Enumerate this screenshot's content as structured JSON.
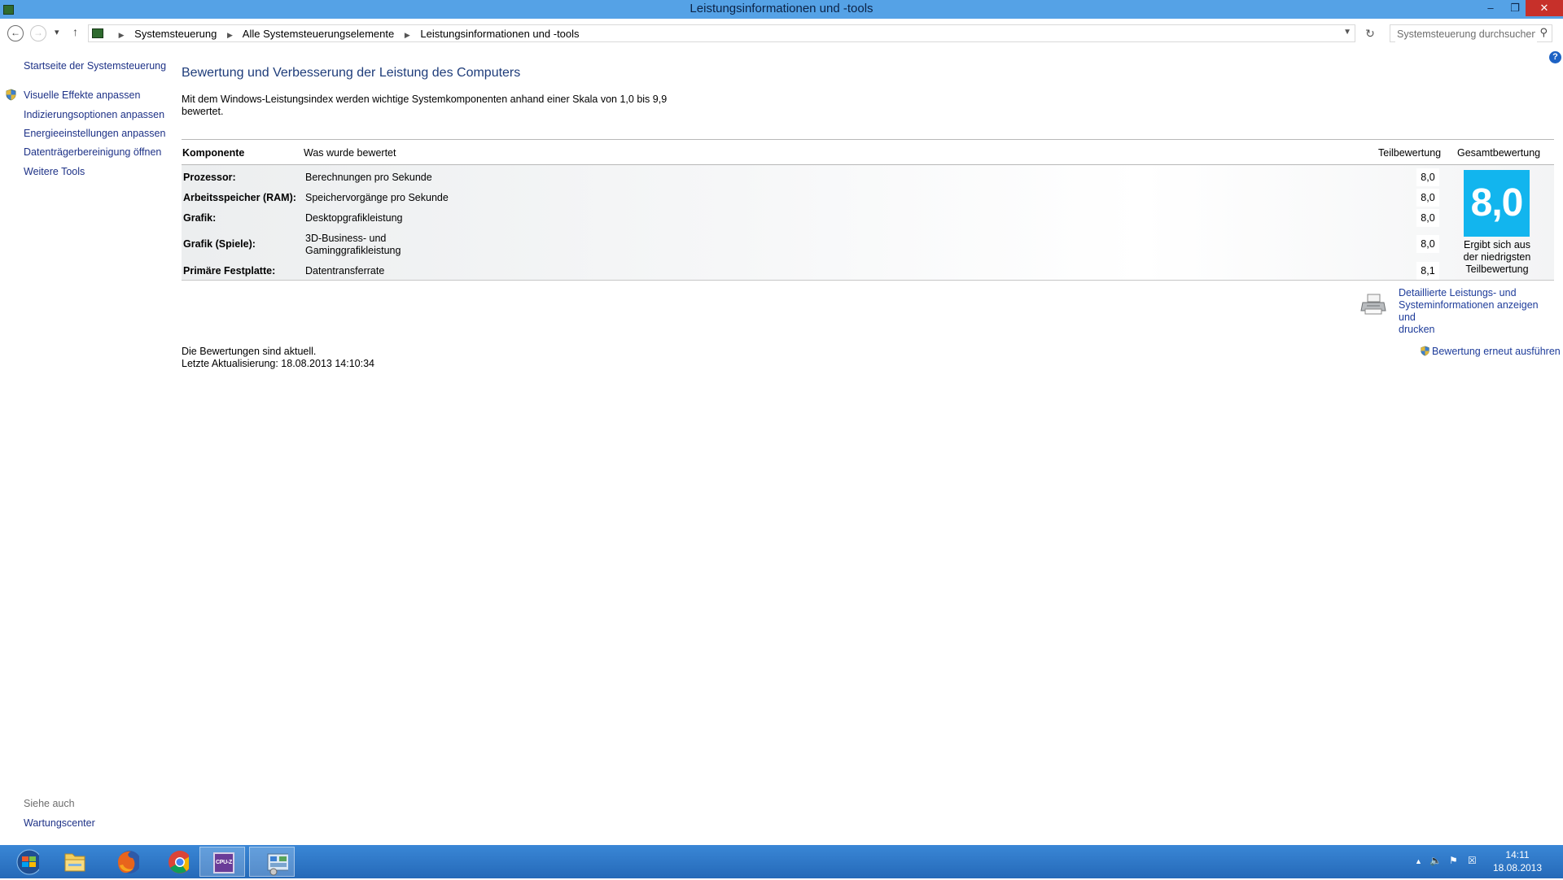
{
  "window": {
    "title": "Leistungsinformationen und -tools",
    "minimize": "–",
    "maximize": "❐",
    "close": "✕"
  },
  "address": {
    "crumbs": [
      "Systemsteuerung",
      "Alle Systemsteuerungselemente",
      "Leistungsinformationen und -tools"
    ],
    "search_placeholder": "Systemsteuerung durchsuchen"
  },
  "sidebar": {
    "home": "Startseite der Systemsteuerung",
    "links": [
      "Visuelle Effekte anpassen",
      "Indizierungsoptionen anpassen",
      "Energieeinstellungen anpassen",
      "Datenträgerbereinigung öffnen",
      "Weitere Tools"
    ],
    "see_also_label": "Siehe auch",
    "see_also_links": [
      "Wartungscenter"
    ]
  },
  "main": {
    "title": "Bewertung und Verbesserung der Leistung des Computers",
    "description": "Mit dem Windows-Leistungsindex werden wichtige Systemkomponenten anhand einer Skala von 1,0 bis 9,9 bewertet.",
    "table": {
      "headers": {
        "component": "Komponente",
        "what": "Was wurde bewertet",
        "subscore": "Teilbewertung",
        "basescore": "Gesamtbewertung"
      },
      "rows": [
        {
          "component": "Prozessor:",
          "what": [
            "Berechnungen pro Sekunde"
          ],
          "score": "8,0"
        },
        {
          "component": "Arbeitsspeicher (RAM):",
          "what": [
            "Speichervorgänge pro Sekunde"
          ],
          "score": "8,0"
        },
        {
          "component": "Grafik:",
          "what": [
            "Desktopgrafikleistung"
          ],
          "score": "8,0"
        },
        {
          "component": "Grafik (Spiele):",
          "what": [
            "3D-Business- und",
            "Gaminggrafikleistung"
          ],
          "score": "8,0"
        },
        {
          "component": "Primäre Festplatte:",
          "what": [
            "Datentransferrate"
          ],
          "score": "8,1"
        }
      ],
      "base_score": "8,0",
      "base_note": [
        "Ergibt sich aus",
        "der niedrigsten",
        "Teilbewertung"
      ]
    },
    "detail_link": [
      "Detaillierte Leistungs- und",
      "Systeminformationen anzeigen und",
      "drucken"
    ],
    "status_current": "Die Bewertungen sind aktuell.",
    "last_update": "Letzte Aktualisierung: 18.08.2013 14:10:34",
    "rerun": "Bewertung erneut ausführen"
  },
  "taskbar": {
    "items": [
      "start-button",
      "file-explorer-icon",
      "firefox-icon",
      "chrome-icon",
      "cpuz-icon",
      "control-panel-icon"
    ],
    "cpuz_text": "CPU-Z",
    "time": "14:11",
    "date": "18.08.2013"
  },
  "colors": {
    "titlebar": "#55a2e6",
    "link": "#1e3287",
    "score_tile": "#12b5ee",
    "taskbar": "#2d74c5"
  }
}
